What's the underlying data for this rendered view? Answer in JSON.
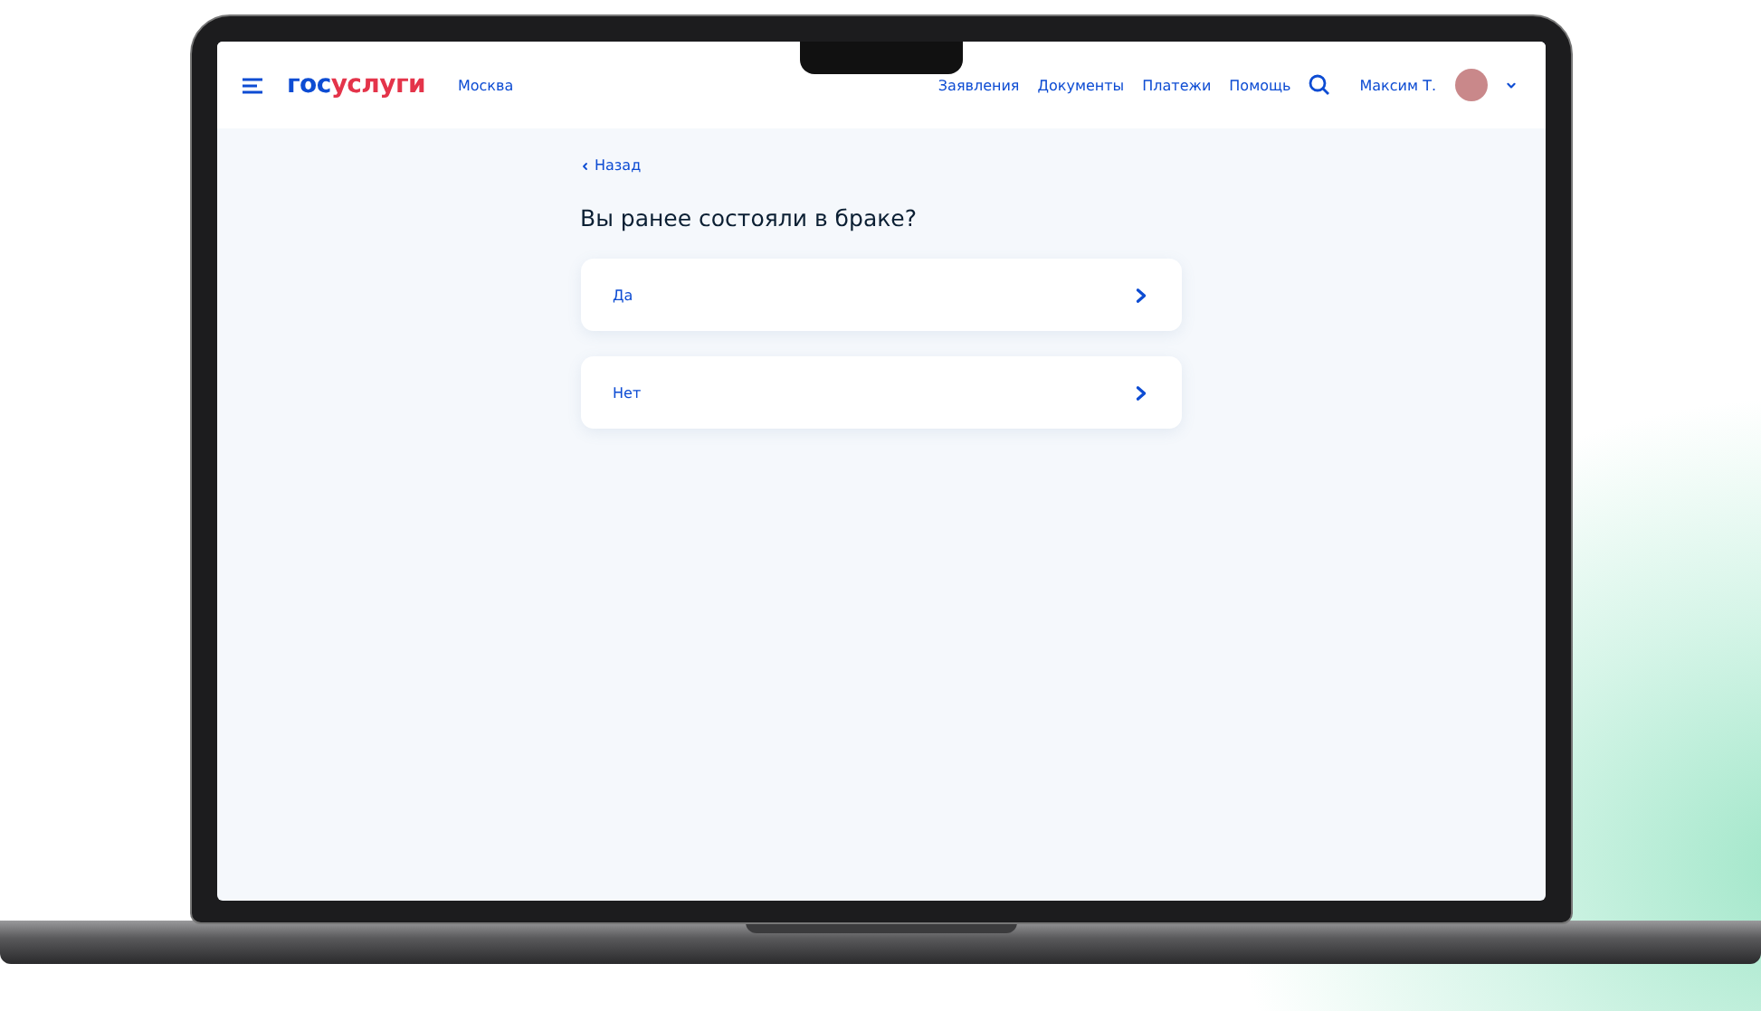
{
  "header": {
    "logo": [
      {
        "text": "гос",
        "color": "#0d4cd3"
      },
      {
        "text": "услуги",
        "color": "#e4344a"
      }
    ],
    "city": "Москва",
    "nav": [
      "Заявления",
      "Документы",
      "Платежи",
      "Помощь"
    ],
    "user": "Максим Т."
  },
  "back": "Назад",
  "question": "Вы ранее состояли в браке?",
  "options": [
    {
      "label": "Да"
    },
    {
      "label": "Нет"
    }
  ]
}
